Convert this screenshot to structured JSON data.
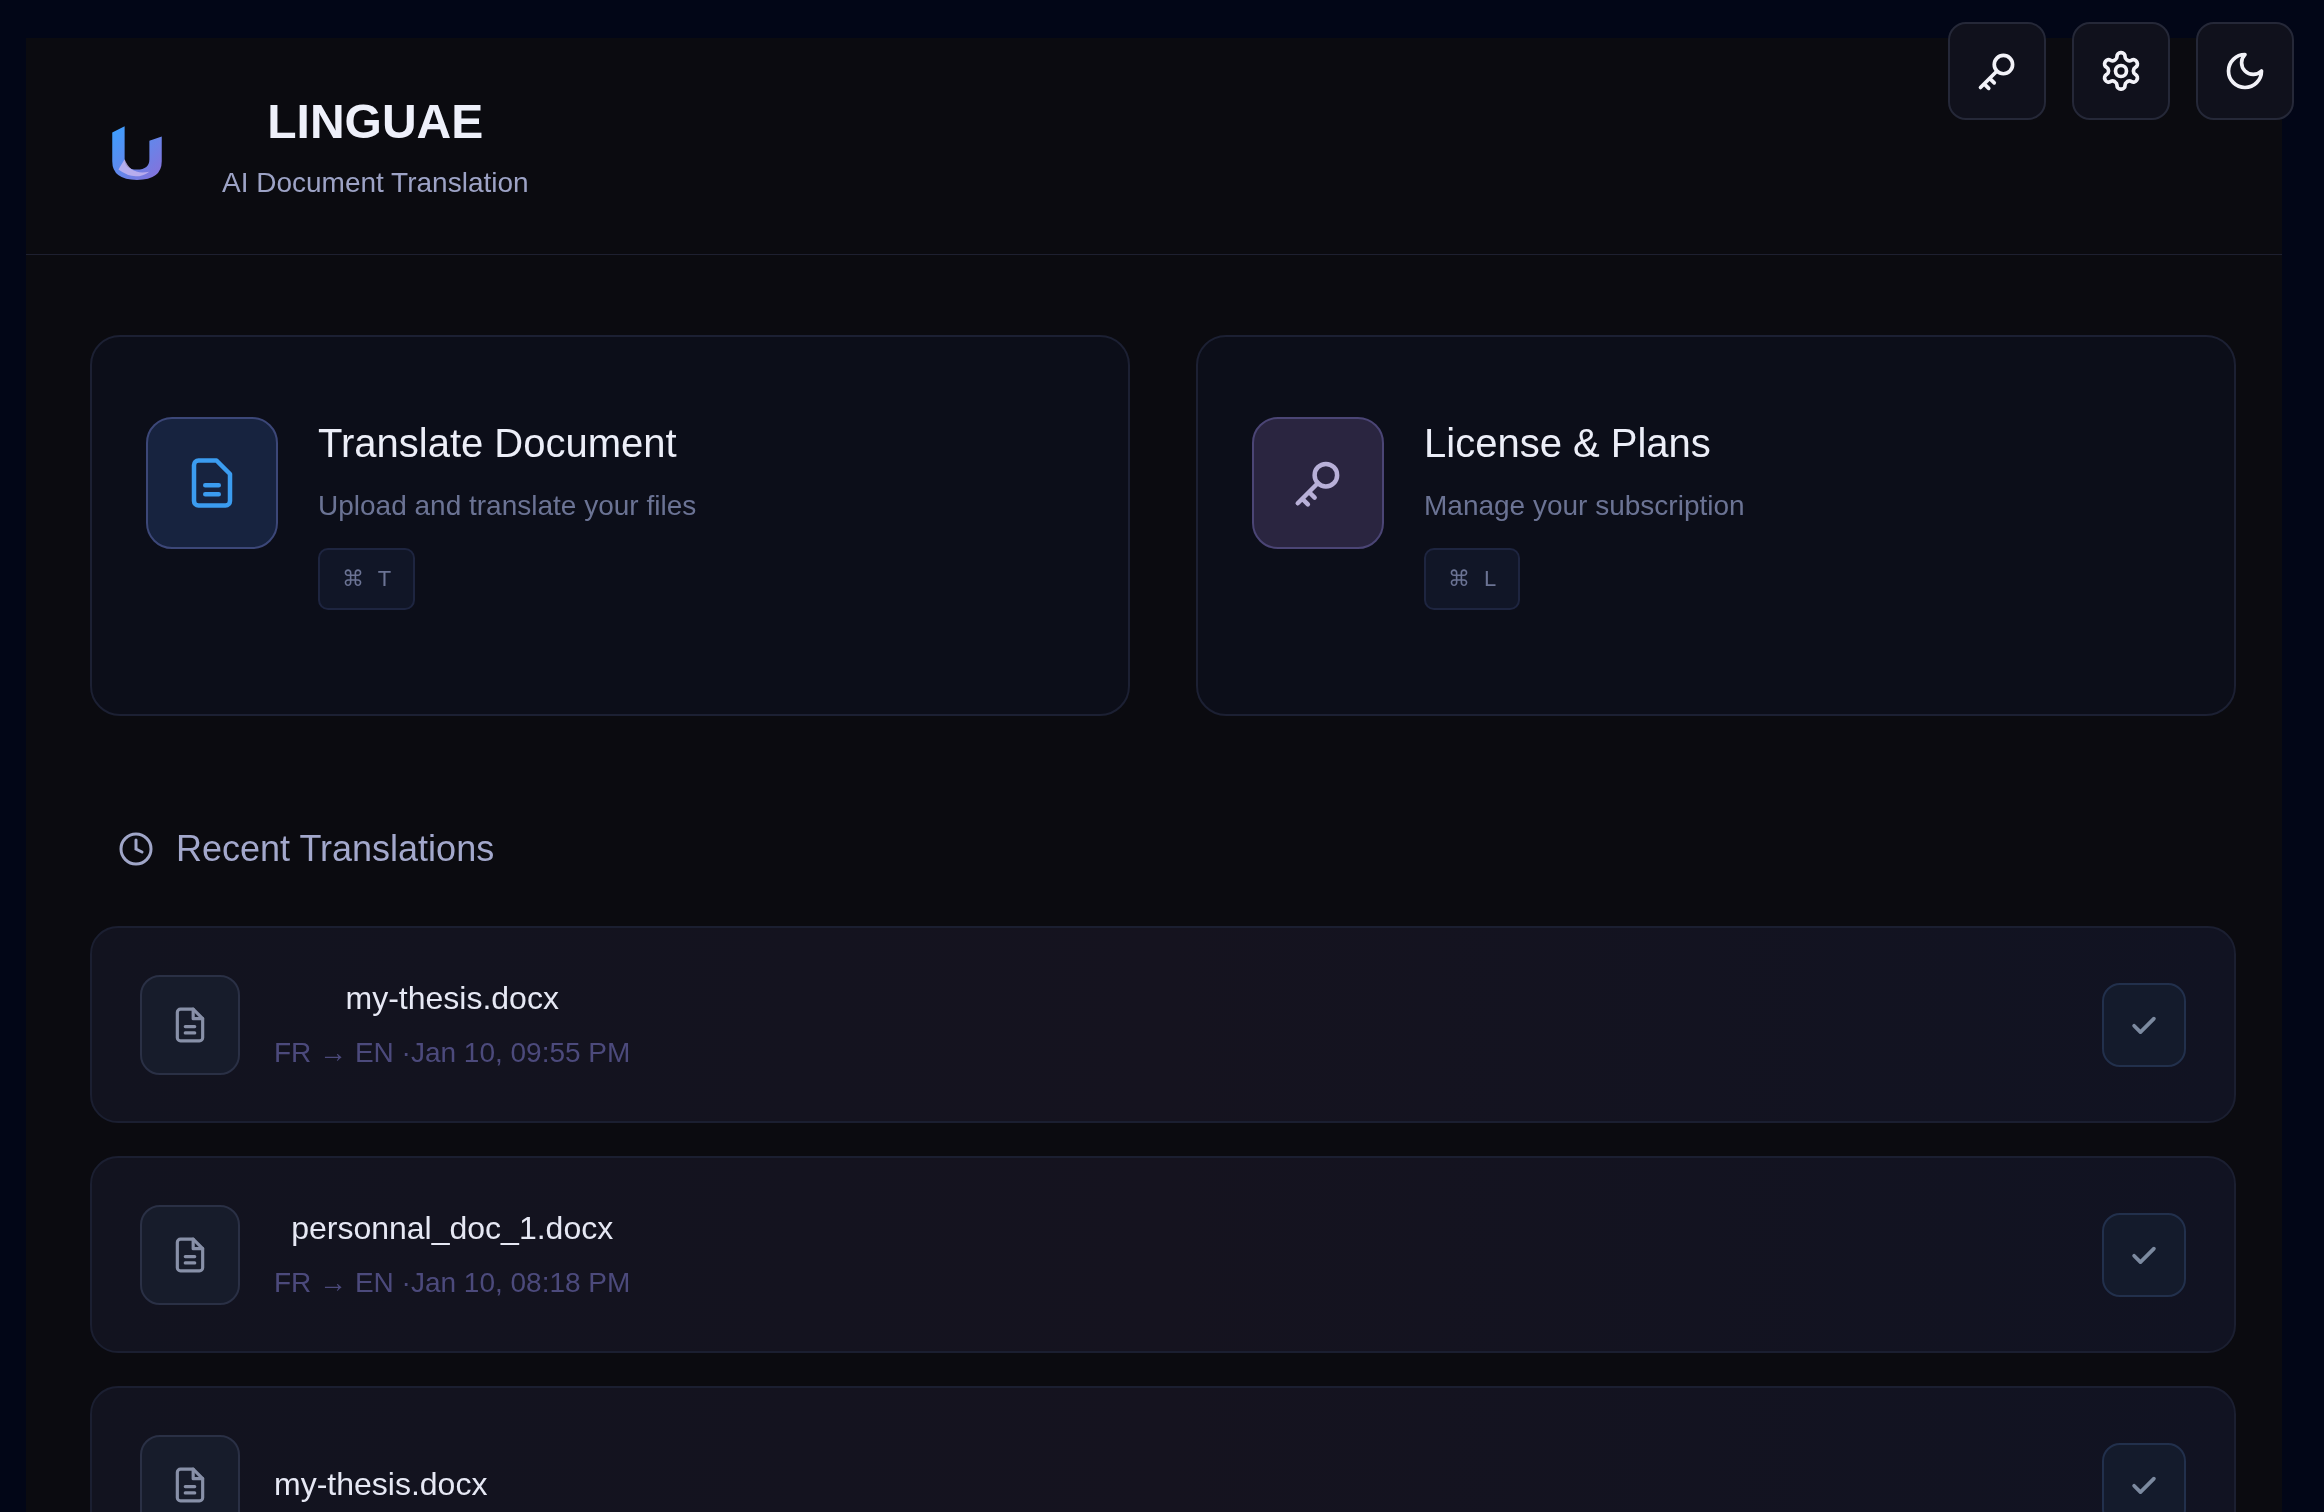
{
  "header": {
    "title": "LINGUAE",
    "subtitle": "AI Document Translation"
  },
  "cards": [
    {
      "kind": "document",
      "color": "#3b9cf0",
      "title": "Translate Document",
      "subtitle": "Upload and translate your files",
      "shortcut": "⌘ T"
    },
    {
      "kind": "key",
      "color": "#b8b0d8",
      "title": "License & Plans",
      "subtitle": "Manage your subscription",
      "shortcut": "⌘ L"
    }
  ],
  "recent": {
    "heading": "Recent Translations",
    "items": [
      {
        "name": "my-thesis.docx",
        "meta": "FR → EN ·Jan 10, 09:55 PM",
        "done": true
      },
      {
        "name": "personnal_doc_1.docx",
        "meta": "FR → EN ·Jan 10, 08:18 PM",
        "done": true
      },
      {
        "name": "my-thesis.docx",
        "done": true
      }
    ]
  }
}
